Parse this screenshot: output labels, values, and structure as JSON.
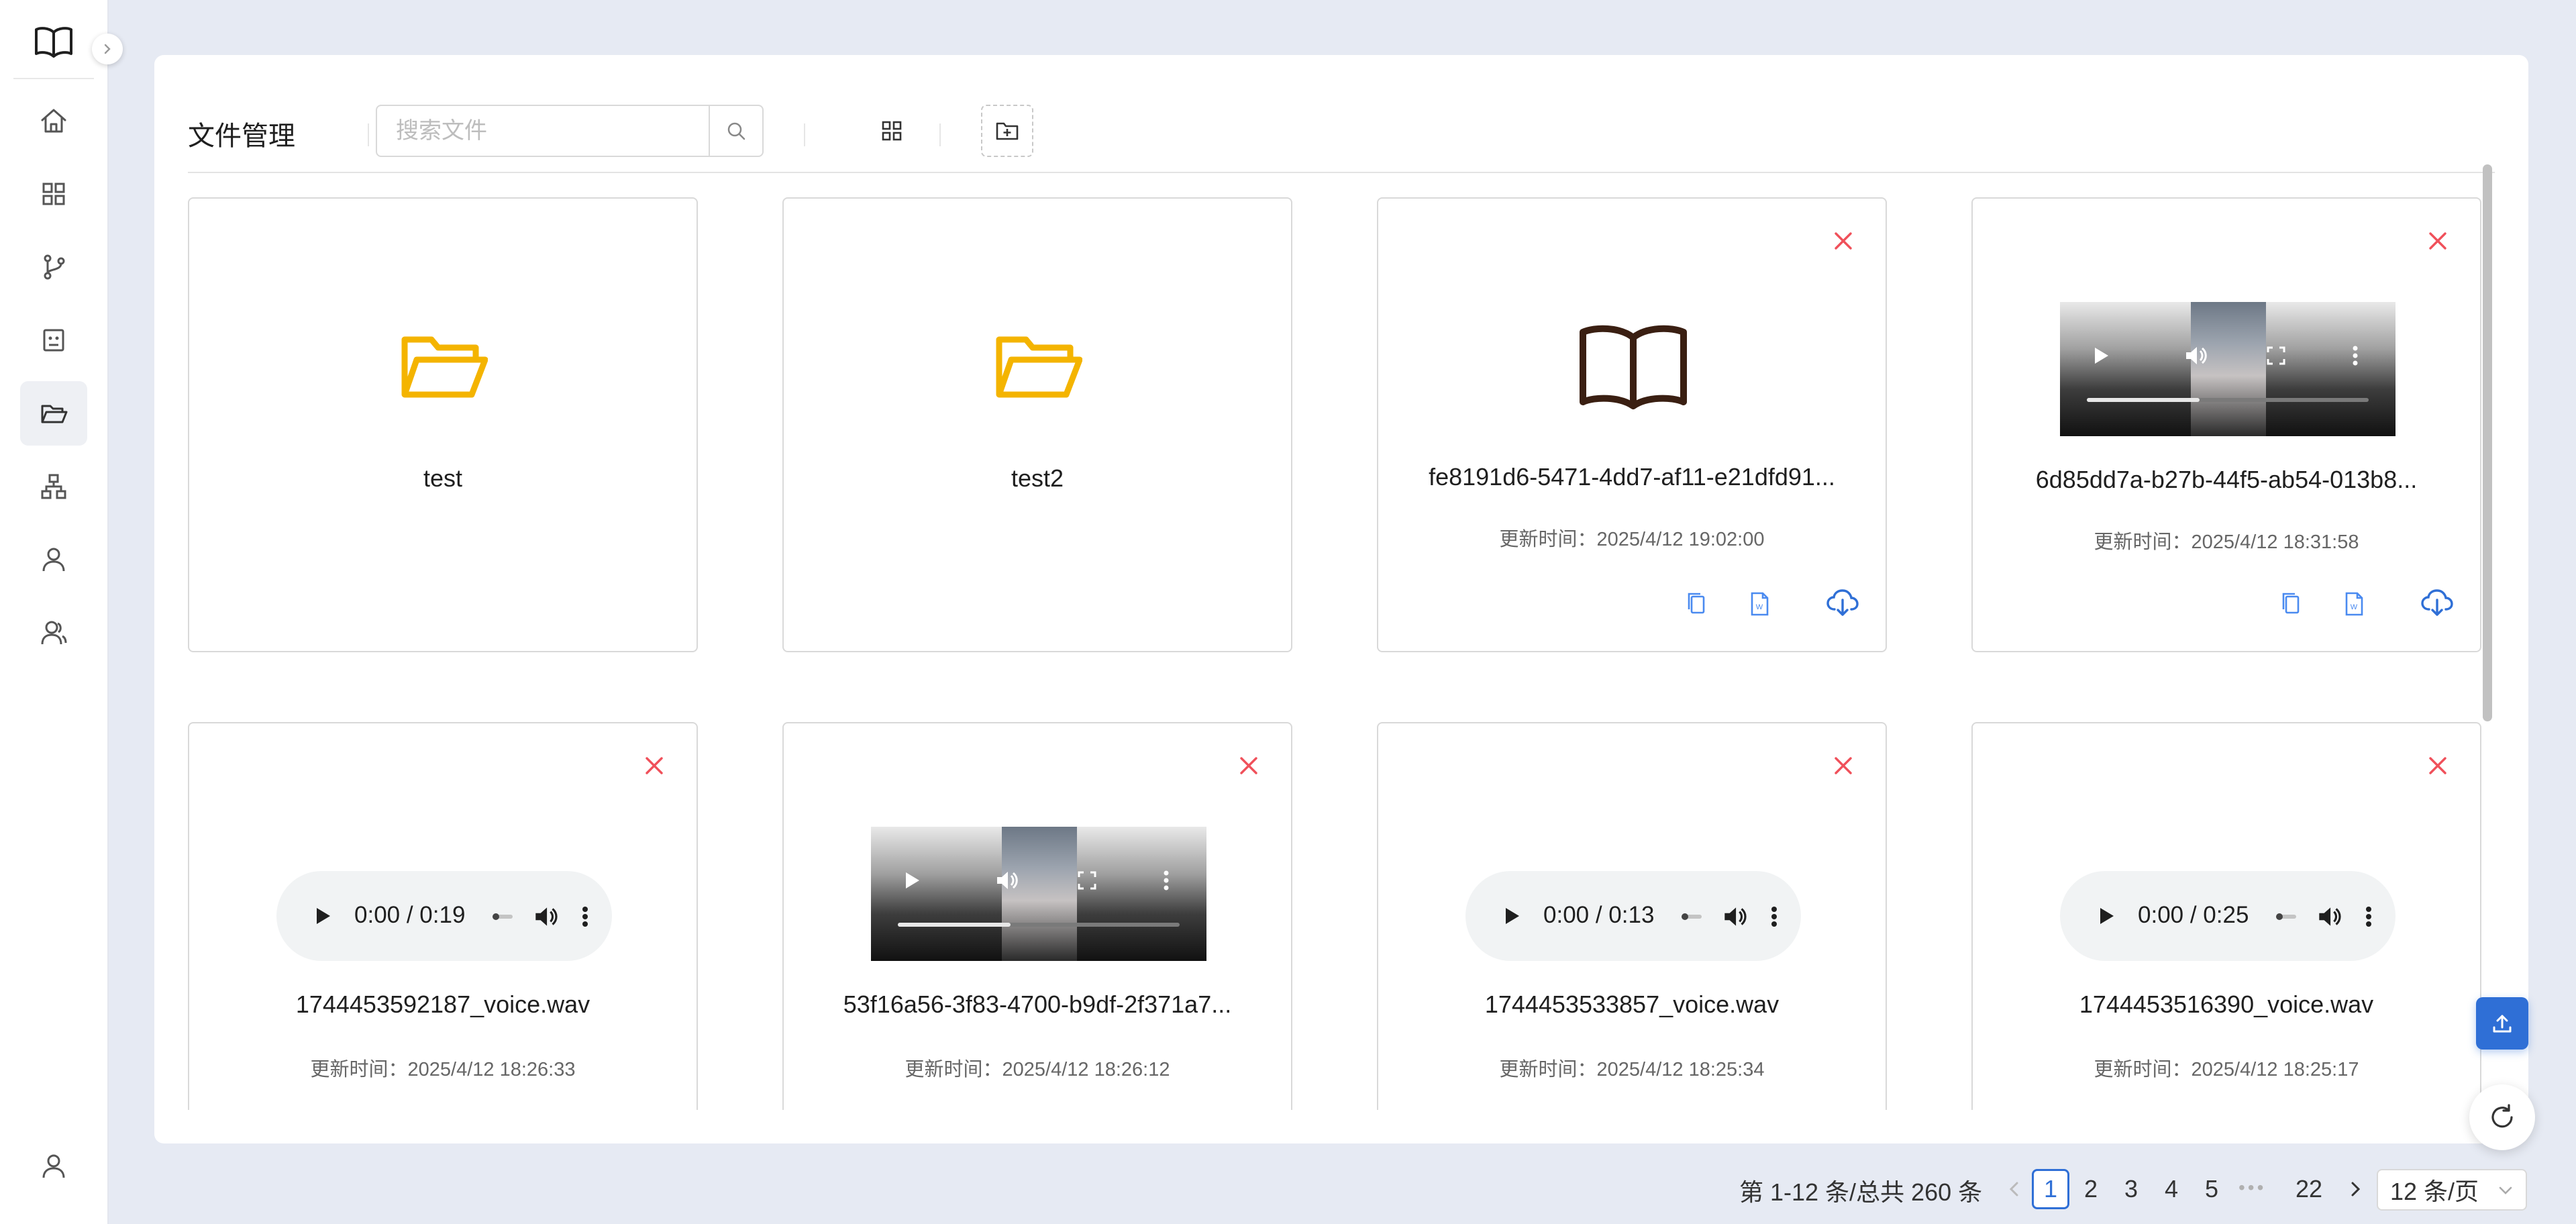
{
  "app": {
    "title": "文件管理"
  },
  "colors": {
    "primary": "#2f6fd6",
    "danger": "#f0505a",
    "folder": "#f4b400"
  },
  "sidebar": {
    "logo_icon": "open-book-icon",
    "toggle_icon": "chevron-right-icon",
    "items": [
      {
        "id": "home",
        "icon": "home-icon"
      },
      {
        "id": "dashboard",
        "icon": "grid-icon"
      },
      {
        "id": "workflow",
        "icon": "git-branch-icon"
      },
      {
        "id": "robot",
        "icon": "robot-icon"
      },
      {
        "id": "files",
        "icon": "folder-open-icon",
        "active": true
      },
      {
        "id": "organization",
        "icon": "sitemap-icon"
      },
      {
        "id": "user",
        "icon": "user-icon"
      },
      {
        "id": "team",
        "icon": "users-icon"
      }
    ],
    "bottom_icon": "user-icon"
  },
  "toolbar": {
    "search_placeholder": "搜索文件",
    "search_value": "",
    "search_icon": "search-icon",
    "view_icon": "grid-view-icon",
    "new_folder_icon": "folder-add-icon"
  },
  "files": [
    {
      "type": "folder",
      "name": "test"
    },
    {
      "type": "folder",
      "name": "test2"
    },
    {
      "type": "document",
      "name": "fe8191d6-5471-4dd7-af11-e21dfd91...",
      "time": "更新时间：2025/4/12 19:02:00"
    },
    {
      "type": "video",
      "name": "6d85dd7a-b27b-44f5-ab54-013b8...",
      "time": "更新时间：2025/4/12 18:31:58",
      "progress": 0.4
    },
    {
      "type": "audio",
      "name": "1744453592187_voice.wav",
      "time": "更新时间：2025/4/12 18:26:33",
      "player_time": "0:00 / 0:19"
    },
    {
      "type": "video",
      "name": "53f16a56-3f83-4700-b9df-2f371a7...",
      "time": "更新时间：2025/4/12 18:26:12",
      "progress": 0.4
    },
    {
      "type": "audio",
      "name": "1744453533857_voice.wav",
      "time": "更新时间：2025/4/12 18:25:34",
      "player_time": "0:00 / 0:13"
    },
    {
      "type": "audio",
      "name": "1744453516390_voice.wav",
      "time": "更新时间：2025/4/12 18:25:17",
      "player_time": "0:00 / 0:25"
    }
  ],
  "card_actions": [
    "copy-icon",
    "file-info-icon",
    "cloud-download-icon"
  ],
  "pagination": {
    "summary": "第 1-12 条/总共 260 条",
    "pages": [
      "1",
      "2",
      "3",
      "4",
      "5"
    ],
    "current": "1",
    "last": "22",
    "page_size": "12 条/页"
  }
}
